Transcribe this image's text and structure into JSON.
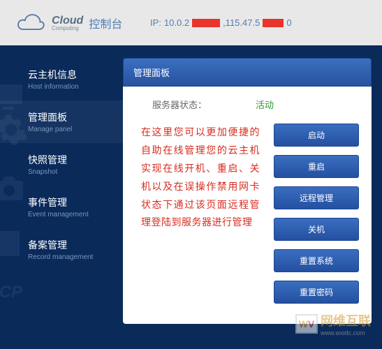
{
  "header": {
    "logo_main": "Cloud",
    "logo_sub": "Computing",
    "logo_console": "控制台",
    "ip_label": "IP:",
    "ip_part1": "10.0.2",
    "ip_part2": ",115.47.5",
    "ip_part3": "0"
  },
  "sidebar": {
    "items": [
      {
        "zh": "云主机信息",
        "en": "Host information"
      },
      {
        "zh": "管理面板",
        "en": "Manage panel"
      },
      {
        "zh": "快照管理",
        "en": "Snapshot"
      },
      {
        "zh": "事件管理",
        "en": "Event management"
      },
      {
        "zh": "备案管理",
        "en": "Record management"
      }
    ]
  },
  "panel": {
    "title": "管理面板",
    "status_label": "服务器状态：",
    "status_value": "活动",
    "description": "在这里您可以更加便捷的自助在线管理您的云主机实现在线开机、重启、关机以及在误操作禁用网卡状态下通过该页面远程管理登陆到服务器进行管理",
    "actions": [
      {
        "label": "启动"
      },
      {
        "label": "重启"
      },
      {
        "label": "远程管理"
      },
      {
        "label": "关机"
      },
      {
        "label": "重置系统"
      },
      {
        "label": "重置密码"
      }
    ]
  },
  "watermark": {
    "brand_cn": "网维互联",
    "brand_en": "www.wxidc.com"
  }
}
